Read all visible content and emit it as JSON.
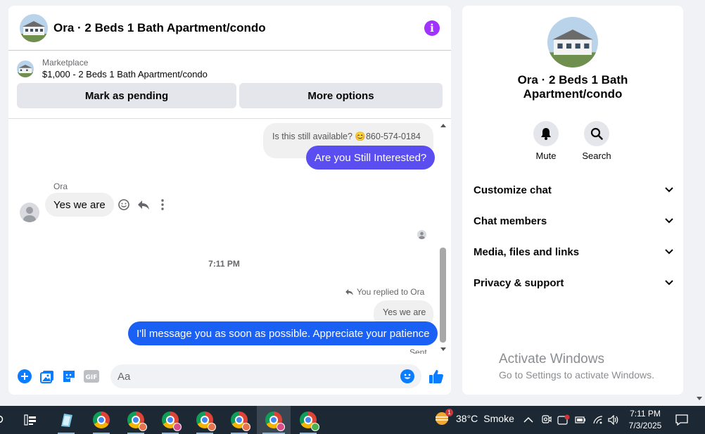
{
  "chat": {
    "title": "Ora · 2 Beds 1 Bath Apartment/condo",
    "marketplace_label": "Marketplace",
    "listing": "$1,000 - 2 Beds 1 Bath Apartment/condo",
    "mark_pending_label": "Mark as pending",
    "more_options_label": "More options"
  },
  "messages": {
    "auto_question": "Is this still available? 😊860-574-0184",
    "out_1": "Are you Still Interested?",
    "sender_name": "Ora",
    "in_1": "Yes we are",
    "timestamp": "7:11 PM",
    "replied_to": "You replied to Ora",
    "quoted": "Yes we are",
    "out_2": "I'll message you as soon as possible. Appreciate your patience",
    "status": "Sent"
  },
  "composer": {
    "placeholder": "Aa"
  },
  "side": {
    "name": "Ora · 2 Beds 1 Bath Apartment/condo",
    "mute_label": "Mute",
    "search_label": "Search",
    "sections": [
      "Customize chat",
      "Chat members",
      "Media, files and links",
      "Privacy & support"
    ],
    "watermark_title": "Activate Windows",
    "watermark_sub": "Go to Settings to activate Windows."
  },
  "taskbar": {
    "temperature": "38°C",
    "weather": "Smoke",
    "weather_badge": "1",
    "time": "7:11 PM",
    "date": "7/3/2025"
  },
  "colors": {
    "accent_blue": "#1b60f5",
    "accent_purple": "#5b4ef0",
    "info": "#a033ff",
    "messenger_blue": "#0a7cff"
  }
}
